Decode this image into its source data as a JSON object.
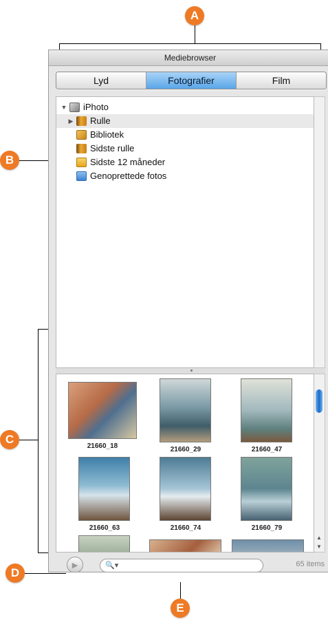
{
  "callouts": [
    "A",
    "B",
    "C",
    "D",
    "E"
  ],
  "window": {
    "title": "Mediebrowser"
  },
  "tabs": [
    {
      "label": "Lyd"
    },
    {
      "label": "Fotografier",
      "selected": true
    },
    {
      "label": "Film"
    }
  ],
  "tree": [
    {
      "label": "iPhoto",
      "expanded": true,
      "icon": "iphoto-icon"
    },
    {
      "label": "Rulle",
      "selected": true,
      "icon": "film-roll-icon"
    },
    {
      "label": "Bibliotek",
      "icon": "library-icon"
    },
    {
      "label": "Sidste rulle",
      "icon": "film-roll-icon"
    },
    {
      "label": "Sidste 12 måneder",
      "icon": "calendar-icon"
    },
    {
      "label": "Genoprettede fotos",
      "icon": "restored-photos-icon"
    }
  ],
  "photos": [
    {
      "label": "21660_18"
    },
    {
      "label": "21660_29"
    },
    {
      "label": "21660_47"
    },
    {
      "label": "21660_63"
    },
    {
      "label": "21660_74"
    },
    {
      "label": "21660_79"
    },
    {
      "label": ""
    },
    {
      "label": ""
    },
    {
      "label": ""
    }
  ],
  "footer": {
    "count": "65 items",
    "search_icon": "magnifier-dropdown-icon",
    "play_icon": "play-icon"
  },
  "colors": {
    "callout": "#ee7a25",
    "active_tab": "#5aa6e8"
  }
}
